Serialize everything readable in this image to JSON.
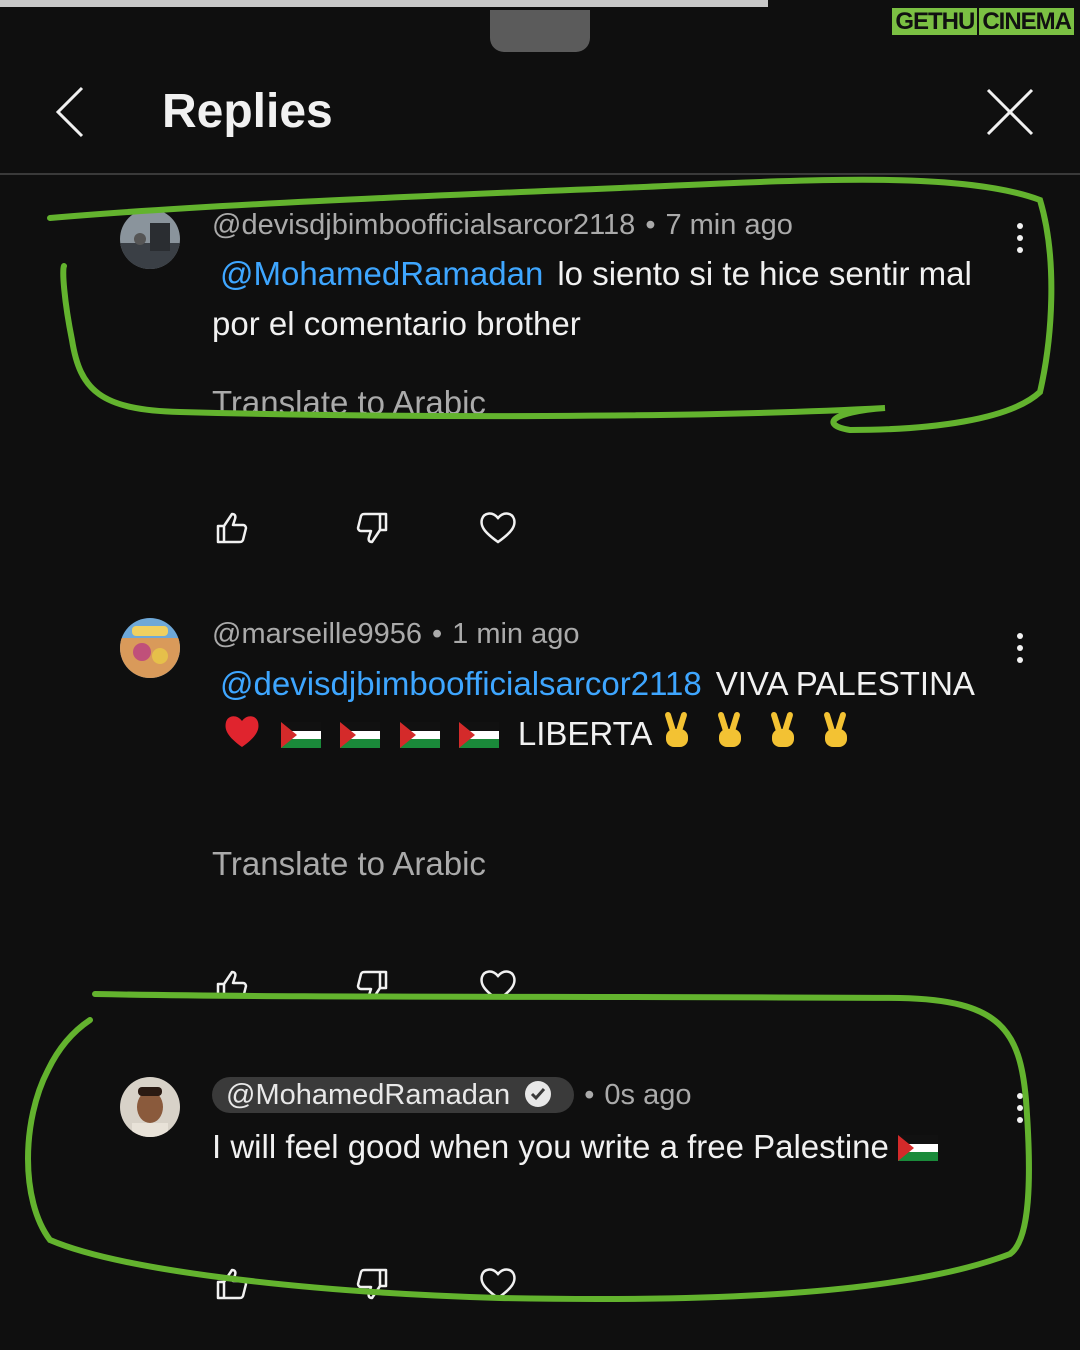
{
  "watermark": {
    "part1": "GETHU",
    "part2": "CINEMA"
  },
  "header": {
    "title": "Replies"
  },
  "comments": [
    {
      "handle": "@devisdjbimboofficialsarcor2118",
      "time": "7 min ago",
      "mention": "@MohamedRamadan",
      "text": "lo siento si te hice sentir mal por el comentario brother",
      "translate": "Translate to Arabic"
    },
    {
      "handle": "@marseille9956",
      "time": "1 min ago",
      "mention": "@devisdjbimboofficialsarcor2118",
      "text_a": "VIVA PALESTINA",
      "text_b": "LIBERTA",
      "translate": "Translate to Arabic"
    },
    {
      "handle": "@MohamedRamadan",
      "time": "0s ago",
      "text": "I will feel good when you write a free Palestine"
    }
  ],
  "colors": {
    "background": "#0f0f0f",
    "mention": "#3ea6ff",
    "highlight": "#63b32e"
  },
  "icons": [
    "back-arrow-icon",
    "close-icon",
    "more-vert-icon",
    "thumb-up-icon",
    "thumb-down-icon",
    "heart-icon",
    "verified-check-icon",
    "palestine-flag-icon",
    "heart-emoji-icon",
    "victory-hand-icon"
  ]
}
